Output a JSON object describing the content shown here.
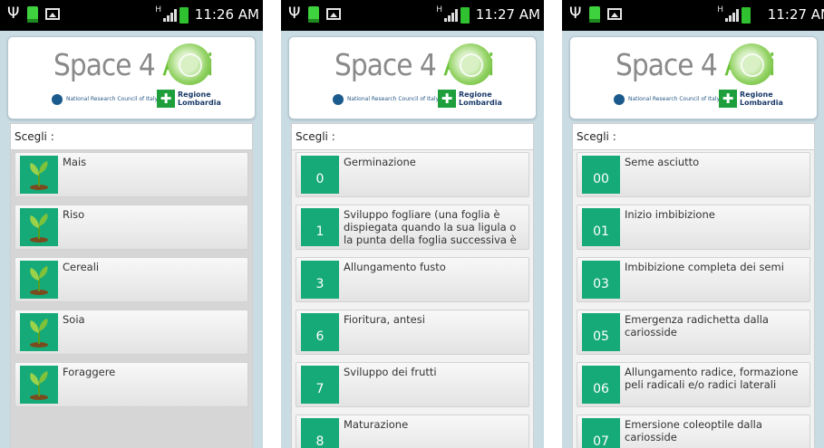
{
  "status_bar": {
    "h_indicator": "H",
    "screens": [
      {
        "time": "11:26 AM"
      },
      {
        "time": "11:27 AM"
      },
      {
        "time": "11:27 AM"
      }
    ]
  },
  "header": {
    "logo_space": "Space 4 ",
    "logo_agri": "Agri",
    "cnr_text": "National Research Council of Italy",
    "regione_line1": "Regione",
    "regione_line2": "Lombardia"
  },
  "list_heading": "Scegli :",
  "screens": [
    {
      "items": [
        {
          "code": "",
          "label": "Mais"
        },
        {
          "code": "",
          "label": "Riso"
        },
        {
          "code": "",
          "label": "Cereali"
        },
        {
          "code": "",
          "label": "Soia"
        },
        {
          "code": "",
          "label": "Foraggere"
        }
      ]
    },
    {
      "items": [
        {
          "code": "0",
          "label": "Germinazione"
        },
        {
          "code": "1",
          "label": "Sviluppo fogliare (una foglia è dispiegata quando la sua ligula o la punta della foglia successiva è"
        },
        {
          "code": "3",
          "label": "Allungamento fusto"
        },
        {
          "code": "6",
          "label": "Fioritura, antesi"
        },
        {
          "code": "7",
          "label": "Sviluppo dei frutti"
        },
        {
          "code": "8",
          "label": "Maturazione"
        }
      ]
    },
    {
      "items": [
        {
          "code": "00",
          "label": "Seme asciutto"
        },
        {
          "code": "01",
          "label": "Inizio imbibizione"
        },
        {
          "code": "03",
          "label": "Imbibizione completa dei semi"
        },
        {
          "code": "05",
          "label": "Emergenza radichetta dalla cariosside"
        },
        {
          "code": "06",
          "label": "Allungamento radice, formazione peli radicali e/o radici laterali"
        },
        {
          "code": "07",
          "label": "Emersione coleoptile dalla cariosside"
        }
      ]
    }
  ],
  "colors": {
    "accent_green": "#17aa79",
    "logo_green": "#6cc23b",
    "background": "#c9dbe3"
  }
}
